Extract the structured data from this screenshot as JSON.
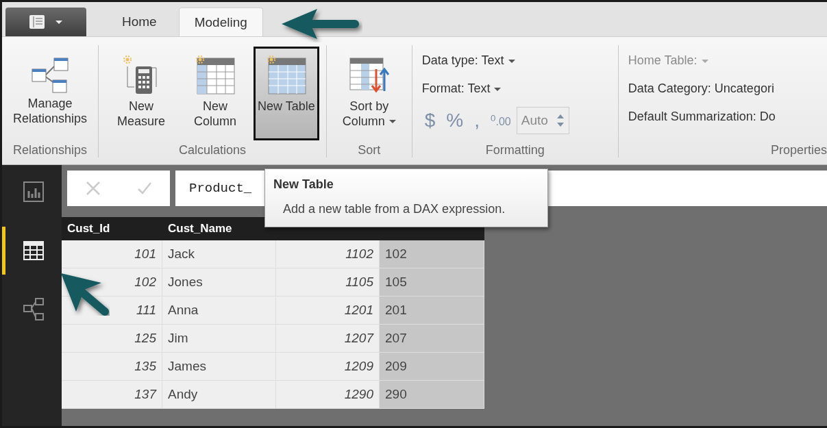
{
  "tabs": [
    {
      "label": "Home",
      "selected": false
    },
    {
      "label": "Modeling",
      "selected": true
    }
  ],
  "ribbon": {
    "groups": [
      {
        "kind": "buttons",
        "label": "Relationships",
        "buttons": [
          {
            "kind": "relationships",
            "label": "Manage Relationships",
            "highlighted": false
          }
        ]
      },
      {
        "kind": "buttons",
        "label": "Calculations",
        "buttons": [
          {
            "kind": "measure",
            "label": "New Measure",
            "highlighted": false
          },
          {
            "kind": "column",
            "label": "New Column",
            "highlighted": false
          },
          {
            "kind": "table",
            "label": "New Table",
            "highlighted": true
          }
        ]
      },
      {
        "kind": "buttons",
        "label": "Sort",
        "buttons": [
          {
            "kind": "sort",
            "label": "Sort by Column",
            "dropdown": true,
            "highlighted": false
          }
        ]
      },
      {
        "kind": "formatting",
        "label": "Formatting",
        "data_type": "Data type: Text",
        "format": "Format: Text",
        "symbols": [
          "$",
          "%",
          ",",
          "$^{0}$.00"
        ],
        "decimals": "Auto"
      },
      {
        "kind": "properties",
        "label": "Properties",
        "fields": [
          {
            "label": "Home Table:",
            "disabled": true
          },
          {
            "label": "Data Category: Uncategori",
            "disabled": false
          },
          {
            "label": "Default Summarization: Do",
            "disabled": false
          }
        ]
      }
    ]
  },
  "sidebar": {
    "items": [
      {
        "kind": "report",
        "selected": false
      },
      {
        "kind": "data",
        "selected": true
      },
      {
        "kind": "relationships",
        "selected": false
      }
    ]
  },
  "formula_bar": {
    "value": "Product_"
  },
  "tooltip": {
    "title": "New Table",
    "description": "Add a new table from a DAX expression."
  },
  "table": {
    "columns": [
      "Cust_Id",
      "Cust_Name"
    ],
    "rows": [
      [
        "101",
        "Jack",
        "1102",
        "102"
      ],
      [
        "102",
        "Jones",
        "1105",
        "105"
      ],
      [
        "111",
        "Anna",
        "1201",
        "201"
      ],
      [
        "125",
        "Jim",
        "1207",
        "207"
      ],
      [
        "135",
        "James",
        "1209",
        "209"
      ],
      [
        "137",
        "Andy",
        "1290",
        "290"
      ]
    ]
  }
}
